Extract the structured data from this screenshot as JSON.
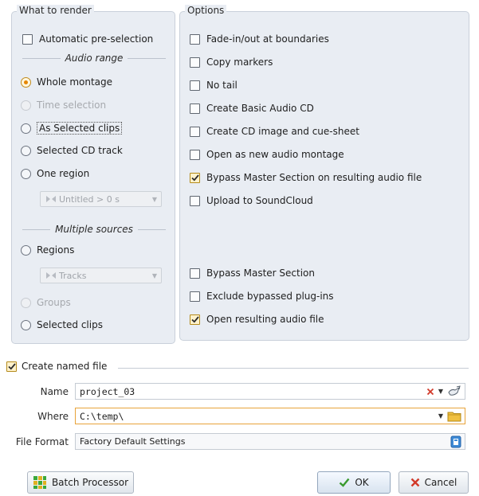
{
  "what_to_render": {
    "title": "What to render",
    "automatic_preselection": {
      "label": "Automatic pre-selection",
      "checked": false
    },
    "audio_range": {
      "title": "Audio range",
      "options": [
        {
          "label": "Whole montage",
          "selected": true,
          "enabled": true
        },
        {
          "label": "Time selection",
          "selected": false,
          "enabled": false
        },
        {
          "label": "As Selected clips",
          "selected": false,
          "enabled": true
        },
        {
          "label": "Selected CD track",
          "selected": false,
          "enabled": true
        },
        {
          "label": "One region",
          "selected": false,
          "enabled": true
        }
      ],
      "region_combo": "Untitled > 0 s"
    },
    "multiple_sources": {
      "title": "Multiple sources",
      "regions_label": "Regions",
      "tracks_combo": "Tracks",
      "groups_label": "Groups",
      "selected_clips_label": "Selected clips"
    }
  },
  "options": {
    "title": "Options",
    "items": [
      {
        "label": "Fade-in/out at boundaries",
        "checked": false
      },
      {
        "label": "Copy markers",
        "checked": false
      },
      {
        "label": "No tail",
        "checked": false
      },
      {
        "label": "Create Basic Audio CD",
        "checked": false
      },
      {
        "label": "Create CD image and cue-sheet",
        "checked": false
      },
      {
        "label": "Open as new audio montage",
        "checked": false
      },
      {
        "label": "Bypass Master Section on resulting audio file",
        "checked": true
      },
      {
        "label": "Upload to SoundCloud",
        "checked": false
      }
    ],
    "bottom_items": [
      {
        "label": "Bypass Master Section",
        "checked": false
      },
      {
        "label": "Exclude bypassed plug-ins",
        "checked": false
      },
      {
        "label": "Open resulting audio file",
        "checked": true
      }
    ]
  },
  "named_file": {
    "label": "Create named file",
    "checked": true,
    "name_label": "Name",
    "name_value": "project_03",
    "where_label": "Where",
    "where_value": "C:\\temp\\",
    "format_label": "File Format",
    "format_value": "Factory Default Settings"
  },
  "buttons": {
    "batch": "Batch Processor",
    "ok": "OK",
    "cancel": "Cancel"
  },
  "colors": {
    "accent_orange": "#e68600",
    "check_mark": "#2b2b2b",
    "ok_green": "#3a9a2f",
    "cancel_red": "#d23a2a",
    "folder_yellow": "#f0c040"
  }
}
